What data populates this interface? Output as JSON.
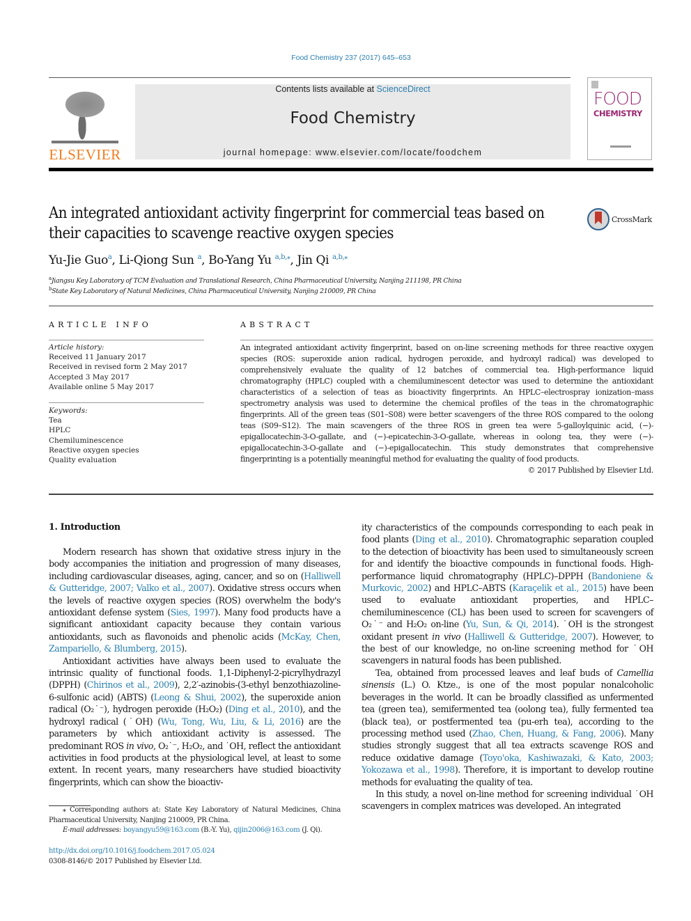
{
  "header": {
    "citation": "Food Chemistry 237 (2017) 645–653",
    "contents_prefix": "Contents lists available at ",
    "contents_link": "ScienceDirect",
    "journal_title": "Food Chemistry",
    "homepage": "journal homepage: www.elsevier.com/locate/foodchem",
    "publisher_logo_text": "ELSEVIER",
    "cover_word_1": "FOOD",
    "cover_word_2": "CHEMISTRY",
    "crossmark_label": "CrossMark"
  },
  "article": {
    "title": "An integrated antioxidant activity fingerprint for commercial teas based on their capacities to scavenge reactive oxygen species",
    "authors": [
      {
        "name": "Yu-Jie Guo",
        "sup": "a"
      },
      {
        "name": "Li-Qiong Sun",
        "sup": "a"
      },
      {
        "name": "Bo-Yang Yu",
        "sup": "a,b,⁎"
      },
      {
        "name": "Jin Qi",
        "sup": "a,b,⁎"
      }
    ],
    "affiliations": [
      {
        "mark": "a",
        "text": "Jiangsu Key Laboratory of TCM Evaluation and Translational Research, China Pharmaceutical University, Nanjing 211198, PR China"
      },
      {
        "mark": "b",
        "text": "State Key Laboratory of Natural Medicines, China Pharmaceutical University, Nanjing 210009, PR China"
      }
    ]
  },
  "article_info": {
    "heading": "ARTICLE INFO",
    "history_label": "Article history:",
    "history": [
      "Received 11 January 2017",
      "Received in revised form 2 May 2017",
      "Accepted 3 May 2017",
      "Available online 5 May 2017"
    ],
    "keywords_label": "Keywords:",
    "keywords": [
      "Tea",
      "HPLC",
      "Chemiluminescence",
      "Reactive oxygen species",
      "Quality evaluation"
    ]
  },
  "abstract": {
    "heading": "ABSTRACT",
    "text": "An integrated antioxidant activity fingerprint, based on on-line screening methods for three reactive oxygen species (ROS: superoxide anion radical, hydrogen peroxide, and hydroxyl radical) was developed to comprehensively evaluate the quality of 12 batches of commercial tea. High-performance liquid chromatography (HPLC) coupled with a chemiluminescent detector was used to determine the antioxidant characteristics of a selection of teas as bioactivity fingerprints. An HPLC–electrospray ionization–mass spectrometry analysis was used to determine the chemical profiles of the teas in the chromatographic fingerprints. All of the green teas (S01–S08) were better scavengers of the three ROS compared to the oolong teas (S09–S12). The main scavengers of the three ROS in green tea were 5-galloylquinic acid, (−)-epigallocatechin-3-O-gallate, and (−)-epicatechin-3-O-gallate, whereas in oolong tea, they were (−)-epigallocatechin-3-O-gallate and (−)-epigallocatechin. This study demonstrates that comprehensive fingerprinting is a potentially meaningful method for evaluating the quality of food products.",
    "copyright": "© 2017 Published by Elsevier Ltd."
  },
  "body": {
    "section_heading": "1. Introduction",
    "left_paragraphs": [
      [
        {
          "t": "Modern research has shown that oxidative stress injury in the body accompanies the initiation and progression of many diseases, including cardiovascular diseases, aging, cancer, and so on ("
        },
        {
          "t": "Halliwell & Gutteridge, 2007; Valko et al., 2007",
          "link": true
        },
        {
          "t": "). Oxidative stress occurs when the levels of reactive oxygen species (ROS) overwhelm the body's antioxidant defense system ("
        },
        {
          "t": "Sies, 1997",
          "link": true
        },
        {
          "t": "). Many food products have a significant antioxidant capacity because they contain various antioxidants, such as flavonoids and phenolic acids ("
        },
        {
          "t": "McKay, Chen, Zampariello, & Blumberg, 2015",
          "link": true
        },
        {
          "t": ")."
        }
      ],
      [
        {
          "t": "Antioxidant activities have always been used to evaluate the intrinsic quality of functional foods. 1,1-Diphenyl-2-picrylhydrazyl (DPPH) ("
        },
        {
          "t": "Chirinos et al., 2009",
          "link": true
        },
        {
          "t": "), 2,2′-azinobis-(3-ethyl benzothiazoline-6-sulfonic acid) (ABTS) ("
        },
        {
          "t": "Leong & Shui, 2002",
          "link": true
        },
        {
          "t": "), the superoxide anion radical (O₂˙⁻), hydrogen peroxide (H₂O₂) ("
        },
        {
          "t": "Ding et al., 2010",
          "link": true
        },
        {
          "t": "), and the hydroxyl radical (˙OH) ("
        },
        {
          "t": "Wu, Tong, Wu, Liu, & Li, 2016",
          "link": true
        },
        {
          "t": ") are the parameters by which antioxidant activity is assessed. The predominant ROS "
        },
        {
          "t": "in vivo",
          "italic": true
        },
        {
          "t": ", O₂˙⁻, H₂O₂, and ˙OH, reflect the antioxidant activities in food products at the physiological level, at least to some extent. In recent years, many researchers have studied bioactivity fingerprints, which can show the bioactiv-"
        }
      ]
    ],
    "right_paragraphs": [
      [
        {
          "t": "ity characteristics of the compounds corresponding to each peak in food plants ("
        },
        {
          "t": "Ding et al., 2010",
          "link": true
        },
        {
          "t": "). Chromatographic separation coupled to the detection of bioactivity has been used to simultaneously screen for and identify the bioactive compounds in functional foods. High-performance liquid chromatography (HPLC)–DPPH ("
        },
        {
          "t": "Bandoniene & Murkovic, 2002",
          "link": true
        },
        {
          "t": ") and HPLC–ABTS ("
        },
        {
          "t": "Karaçelik et al., 2015",
          "link": true
        },
        {
          "t": ") have been used to evaluate antioxidant properties, and HPLC–chemiluminescence (CL) has been used to screen for scavengers of O₂˙⁻ and H₂O₂ on-line ("
        },
        {
          "t": "Yu, Sun, & Qi, 2014",
          "link": true
        },
        {
          "t": "). ˙OH is the strongest oxidant present "
        },
        {
          "t": "in vivo",
          "italic": true
        },
        {
          "t": " ("
        },
        {
          "t": "Halliwell & Gutteridge, 2007",
          "link": true
        },
        {
          "t": "). However, to the best of our knowledge, no on-line screening method for ˙OH scavengers in natural foods has been published."
        }
      ],
      [
        {
          "t": "Tea, obtained from processed leaves and leaf buds of "
        },
        {
          "t": "Camellia sinensis",
          "italic": true
        },
        {
          "t": " (L.) O. Ktze., is one of the most popular nonalcoholic beverages in the world. It can be broadly classified as unfermented tea (green tea), semifermented tea (oolong tea), fully fermented tea (black tea), or postfermented tea (pu-erh tea), according to the processing method used ("
        },
        {
          "t": "Zhao, Chen, Huang, & Fang, 2006",
          "link": true
        },
        {
          "t": "). Many studies strongly suggest that all tea extracts scavenge ROS and reduce oxidative damage ("
        },
        {
          "t": "Toyo'oka, Kashiwazaki, & Kato, 2003; Yokozawa et al., 1998",
          "link": true
        },
        {
          "t": "). Therefore, it is important to develop routine methods for evaluating the quality of tea."
        }
      ],
      [
        {
          "t": "In this study, a novel on-line method for screening individual ˙OH scavengers in complex matrices was developed. An integrated"
        }
      ]
    ]
  },
  "footnotes": {
    "corresponding": "⁎ Corresponding authors at: State Key Laboratory of Natural Medicines, China Pharmaceutical University, Nanjing 210009, PR China.",
    "email_label": "E-mail addresses:",
    "email_1": "boyangyu59@163.com",
    "email_1_who": " (B.-Y. Yu), ",
    "email_2": "qijin2006@163.com",
    "email_2_who": " (J. Qi).",
    "doi": "http://dx.doi.org/10.1016/j.foodchem.2017.05.024",
    "issn_line": "0308-8146/© 2017 Published by Elsevier Ltd."
  },
  "colors": {
    "link": "#2a7fb0",
    "elsevier_orange": "#f07c1e",
    "cover_magenta": "#9c2a72"
  }
}
